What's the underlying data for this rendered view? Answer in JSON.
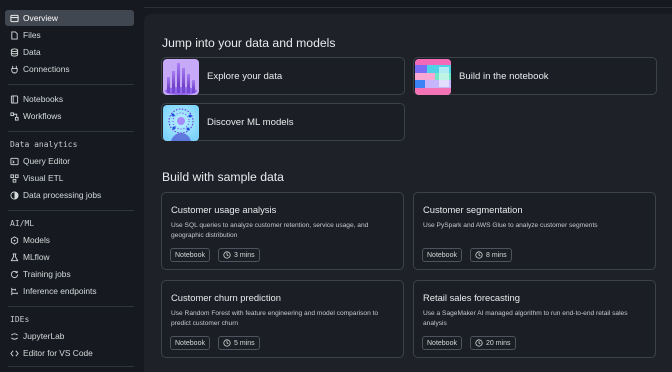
{
  "sidebar": {
    "items": [
      {
        "label": "Overview",
        "icon": "overview-icon",
        "active": true
      },
      {
        "label": "Files",
        "icon": "file-icon"
      },
      {
        "label": "Data",
        "icon": "database-icon"
      },
      {
        "label": "Connections",
        "icon": "connections-icon"
      },
      {
        "label": "Notebooks",
        "icon": "notebook-icon"
      },
      {
        "label": "Workflows",
        "icon": "workflow-icon"
      },
      {
        "label": "Query Editor",
        "icon": "query-editor-icon"
      },
      {
        "label": "Visual ETL",
        "icon": "visual-etl-icon"
      },
      {
        "label": "Data processing jobs",
        "icon": "jobs-icon"
      },
      {
        "label": "Models",
        "icon": "models-icon"
      },
      {
        "label": "MLflow",
        "icon": "mlflow-icon"
      },
      {
        "label": "Training jobs",
        "icon": "training-icon"
      },
      {
        "label": "Inference endpoints",
        "icon": "inference-icon"
      },
      {
        "label": "JupyterLab",
        "icon": "jupyter-icon"
      },
      {
        "label": "Editor for VS Code",
        "icon": "code-icon"
      }
    ],
    "sections": {
      "data_analytics": "Data analytics",
      "ai_ml": "AI/ML",
      "ides": "IDEs"
    }
  },
  "main": {
    "jump_heading": "Jump into your data and models",
    "quick_links": [
      {
        "label": "Explore your data"
      },
      {
        "label": "Build in the notebook"
      },
      {
        "label": "Discover ML models"
      }
    ],
    "sample_heading": "Build with sample data",
    "samples": [
      {
        "title": "Customer usage analysis",
        "description": "Use SQL queries to analyze customer retention, service usage, and geographic distribution",
        "tag": "Notebook",
        "duration": "3 mins"
      },
      {
        "title": "Customer segmentation",
        "description": "Use PySpark and AWS Glue to analyze customer segments",
        "tag": "Notebook",
        "duration": "8 mins"
      },
      {
        "title": "Customer churn prediction",
        "description": "Use Random Forest with feature engineering and model comparison to predict customer churn",
        "tag": "Notebook",
        "duration": "5 mins"
      },
      {
        "title": "Retail sales forecasting",
        "description": "Use a SageMaker AI managed algorithm to run end-to-end retail sales analysis",
        "tag": "Notebook",
        "duration": "20 mins"
      }
    ]
  },
  "colors": {
    "background": "#16191f",
    "panel": "#1e2127",
    "card_border": "#3c424a",
    "active_item": "#414750"
  }
}
